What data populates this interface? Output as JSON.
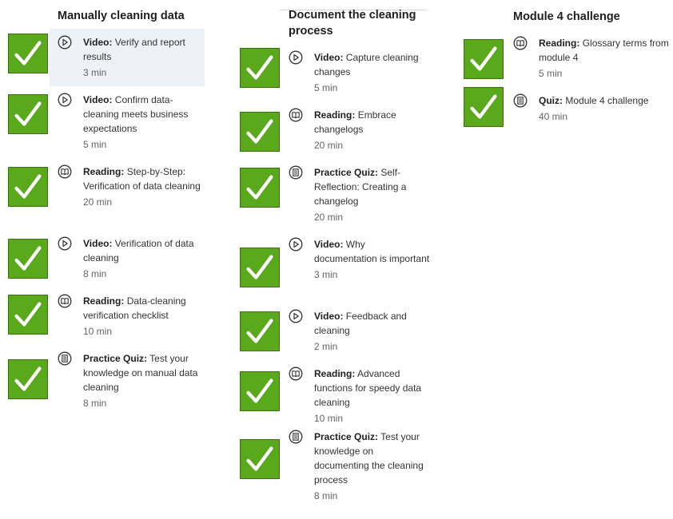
{
  "columns": [
    {
      "title": "Manually cleaning data",
      "items": [
        {
          "type": "Video:",
          "title": "Verify and report results",
          "duration": "3 min",
          "icon": "play-icon"
        },
        {
          "type": "Video:",
          "title": "Confirm data-cleaning meets business expectations",
          "duration": "5 min",
          "icon": "play-icon"
        },
        {
          "type": "Reading:",
          "title": "Step-by-Step: Verification of data cleaning",
          "duration": "20 min",
          "icon": "book-icon"
        },
        {
          "type": "Video:",
          "title": "Verification of data cleaning",
          "duration": "8 min",
          "icon": "play-icon"
        },
        {
          "type": "Reading:",
          "title": "Data-cleaning verification checklist",
          "duration": "10 min",
          "icon": "book-icon"
        },
        {
          "type": "Practice Quiz:",
          "title": "Test your knowledge on manual data cleaning",
          "duration": "8 min",
          "icon": "quiz-icon"
        }
      ]
    },
    {
      "title": "Document the cleaning process",
      "items": [
        {
          "type": "Video:",
          "title": "Capture cleaning changes",
          "duration": "5 min",
          "icon": "play-icon"
        },
        {
          "type": "Reading:",
          "title": "Embrace changelogs",
          "duration": "20 min",
          "icon": "book-icon"
        },
        {
          "type": "Practice Quiz:",
          "title": "Self-Reflection: Creating a changelog",
          "duration": "20 min",
          "icon": "quiz-icon"
        },
        {
          "type": "Video:",
          "title": "Why documentation is important",
          "duration": "3 min",
          "icon": "play-icon"
        },
        {
          "type": "Video:",
          "title": "Feedback and cleaning",
          "duration": "2 min",
          "icon": "play-icon"
        },
        {
          "type": "Reading:",
          "title": "Advanced functions for speedy data cleaning",
          "duration": "10 min",
          "icon": "book-icon"
        },
        {
          "type": "Practice Quiz:",
          "title": "Test your knowledge on documenting the cleaning process",
          "duration": "8 min",
          "icon": "quiz-icon"
        }
      ]
    },
    {
      "title": "Module 4 challenge",
      "items": [
        {
          "type": "Reading:",
          "title": "Glossary terms from module 4",
          "duration": "5 min",
          "icon": "book-icon"
        },
        {
          "type": "Quiz:",
          "title": "Module 4 challenge",
          "duration": "40 min",
          "icon": "quiz-icon"
        }
      ]
    }
  ],
  "colors": {
    "check_green": "#5aa81c",
    "highlight": "#eef2f8"
  }
}
